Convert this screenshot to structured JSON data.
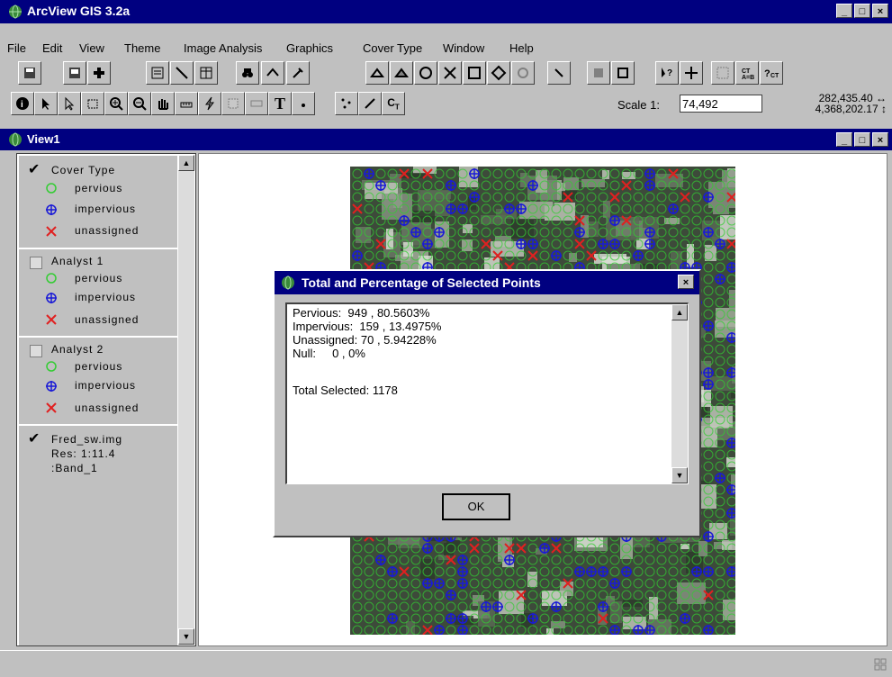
{
  "app": {
    "title": "ArcView GIS 3.2a"
  },
  "menu": [
    "File",
    "Edit",
    "View",
    "Theme",
    "Image Analysis",
    "Graphics",
    "Cover Type",
    "Window",
    "Help"
  ],
  "toolbar2": {
    "scale_label": "Scale 1:",
    "scale_value": "74,492",
    "coord_x": "282,435.40",
    "coord_y": "4,368,202.17"
  },
  "view": {
    "title": "View1"
  },
  "toc": {
    "themes": [
      {
        "name": "Cover Type",
        "checked": true,
        "items": [
          "pervious",
          "impervious",
          "unassigned"
        ]
      },
      {
        "name": "Analyst 1",
        "checked": false,
        "items": [
          "pervious",
          "impervious",
          "unassigned"
        ]
      },
      {
        "name": "Analyst 2",
        "checked": false,
        "items": [
          "pervious",
          "impervious",
          "unassigned"
        ]
      }
    ],
    "image": {
      "name": "Fred_sw.img",
      "res": "Res: 1:11.4",
      "band": ":Band_1",
      "checked": true
    }
  },
  "colors": {
    "pervious": "#33cc33",
    "impervious": "#1a1ad6",
    "unassigned": "#e02020",
    "titlebar": "#000080"
  },
  "dialog": {
    "title": "Total and Percentage of Selected Points",
    "lines": [
      "Pervious:  949 , 80.5603%",
      "Impervious:  159 , 13.4975%",
      "Unassigned: 70 , 5.94228%",
      "Null:     0 , 0%",
      "",
      "Total Selected: 1178"
    ],
    "ok_label": "OK"
  }
}
